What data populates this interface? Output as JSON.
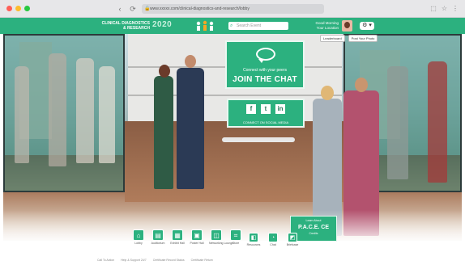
{
  "browser": {
    "url": "www.xxxxx.com/clinical-diagnostics-and-research/lobby",
    "nav_back": "‹",
    "nav_fwd": "›",
    "nav_reload": "⟳",
    "right_icons": [
      "⬚",
      "☆",
      "⋮"
    ]
  },
  "header": {
    "brand_line1": "CLINICAL DIAGNOSTICS",
    "brand_line2": "& RESEARCH",
    "logo_text": "2020",
    "search_placeholder": "Search Event",
    "greeting_line1": "Good Morning",
    "greeting_line2": "Your Location",
    "settings_label": "⚙ ▾"
  },
  "subbar": {
    "chip1": "Leaderboard",
    "chip2": "Post Your Photo"
  },
  "chat_panel": {
    "subtitle": "Connect with your peers",
    "title": "JOIN THE CHAT"
  },
  "social_panel": {
    "buttons": [
      "f",
      "t",
      "in"
    ],
    "caption": "CONNECT ON SOCIAL MEDIA"
  },
  "pace_panel": {
    "top": "Learn About",
    "main": "P.A.C.E. CE",
    "sub": "Credits"
  },
  "dock": {
    "items": [
      {
        "icon": "⌂",
        "label": "Lobby"
      },
      {
        "icon": "▤",
        "label": "Auditorium"
      },
      {
        "icon": "▦",
        "label": "Exhibit Hall"
      },
      {
        "icon": "▣",
        "label": "Poster Hall"
      },
      {
        "icon": "◫",
        "label": "Networking Lounge"
      },
      {
        "icon": "⌗",
        "label": "Store"
      }
    ],
    "items2": [
      {
        "icon": "◧",
        "label": "Resources"
      },
      {
        "icon": "◔",
        "label": "Chat"
      },
      {
        "icon": "◩",
        "label": "Briefcase"
      }
    ]
  },
  "footer": {
    "links": [
      "Call To Action",
      "Help & Support 24/7",
      "Certificate Record Status",
      "Certificate Return"
    ]
  },
  "colors": {
    "accent": "#2cb17f",
    "dark_frame": "#2c3b3b"
  }
}
